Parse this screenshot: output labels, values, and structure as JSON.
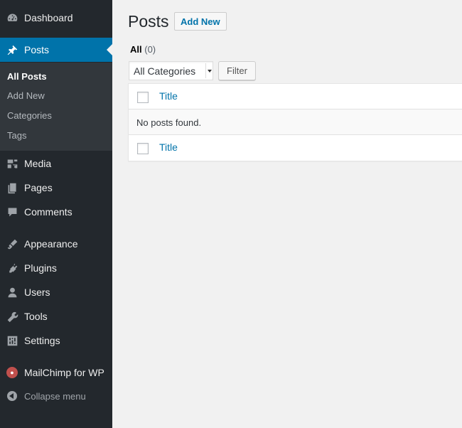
{
  "sidebar": {
    "items": [
      {
        "label": "Dashboard",
        "icon": "dashboard-icon"
      },
      {
        "label": "Posts",
        "icon": "pin-icon"
      },
      {
        "label": "Media",
        "icon": "media-icon"
      },
      {
        "label": "Pages",
        "icon": "pages-icon"
      },
      {
        "label": "Comments",
        "icon": "comments-icon"
      },
      {
        "label": "Appearance",
        "icon": "appearance-icon"
      },
      {
        "label": "Plugins",
        "icon": "plugins-icon"
      },
      {
        "label": "Users",
        "icon": "users-icon"
      },
      {
        "label": "Tools",
        "icon": "tools-icon"
      },
      {
        "label": "Settings",
        "icon": "settings-icon"
      },
      {
        "label": "MailChimp for WP",
        "icon": "mailchimp-icon"
      }
    ],
    "submenu": [
      "All Posts",
      "Add New",
      "Categories",
      "Tags"
    ],
    "collapse_label": "Collapse menu",
    "colors": {
      "background": "#23282d",
      "current": "#0073aa",
      "submenu": "#32373c"
    }
  },
  "main": {
    "title": "Posts",
    "add_new_label": "Add New",
    "filters": {
      "all_label": "All",
      "all_count": "(0)"
    },
    "category_select": {
      "selected": "All Categories"
    },
    "filter_button": "Filter",
    "table": {
      "column_title": "Title",
      "empty_message": "No posts found."
    },
    "colors": {
      "link": "#0073aa"
    }
  }
}
